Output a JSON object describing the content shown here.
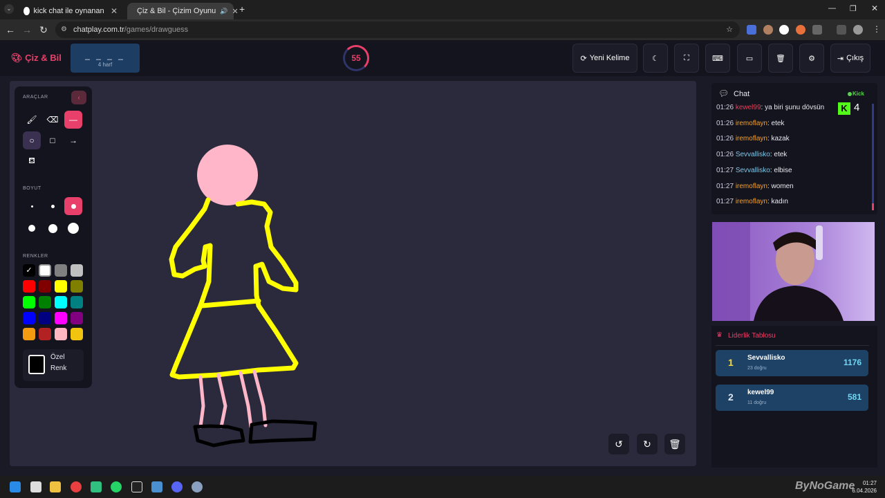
{
  "browser": {
    "tabs": [
      {
        "title": "kick chat ile oynanan oyunlar -",
        "active": false
      },
      {
        "title": "Çiz & Bil - Çizim Oyunu",
        "active": true
      }
    ],
    "url_host": "chatplay.com.tr",
    "url_path": "/games/drawguess"
  },
  "header": {
    "logo": "Çiz & Bil",
    "word_blanks": "_ _ _ _",
    "word_hint": "4 harf",
    "timer": "55",
    "new_word_label": "Yeni Kelime",
    "exit_label": "Çıkış"
  },
  "tools": {
    "section_tools": "ARAÇLAR",
    "section_size": "BOYUT",
    "section_colors": "RENKLER",
    "custom_color_line1": "Özel",
    "custom_color_line2": "Renk",
    "colors": [
      "#000000",
      "#ffffff",
      "#808080",
      "#c0c0c0",
      "#ff0000",
      "#800000",
      "#ffff00",
      "#808000",
      "#00ff00",
      "#008000",
      "#00ffff",
      "#008080",
      "#0000ff",
      "#000080",
      "#ff00ff",
      "#800080",
      "#f39c12",
      "#b22222",
      "#ffb6c1",
      "#f1c40f"
    ],
    "selected_color": "#ffffff"
  },
  "chat": {
    "title": "Chat",
    "source": "Kick",
    "messages": [
      {
        "time": "01:26",
        "user": "kewel99",
        "user_color": "#e0405a",
        "text": ": ya biri şunu dövsün"
      },
      {
        "time": "01:26",
        "user": "iremoflayn",
        "user_color": "#f0a030",
        "text": ": etek"
      },
      {
        "time": "01:26",
        "user": "iremoflayn",
        "user_color": "#f0a030",
        "text": ": kazak"
      },
      {
        "time": "01:26",
        "user": "Sevvallisko",
        "user_color": "#7ec8e8",
        "text": ": etek"
      },
      {
        "time": "01:27",
        "user": "Sevvallisko",
        "user_color": "#7ec8e8",
        "text": ": elbise"
      },
      {
        "time": "01:27",
        "user": "iremoflayn",
        "user_color": "#f0a030",
        "text": ": women"
      },
      {
        "time": "01:27",
        "user": "iremoflayn",
        "user_color": "#f0a030",
        "text": ": kadın"
      }
    ]
  },
  "leaderboard": {
    "title": "Liderlik Tablosu",
    "rows": [
      {
        "rank": "1",
        "name": "Sevvallisko",
        "sub": "23 doğru",
        "score": "1176",
        "rank_color": "#f5d742"
      },
      {
        "rank": "2",
        "name": "kewel99",
        "sub": "11 doğru",
        "score": "581",
        "rank_color": "#dfe7f5"
      }
    ]
  },
  "taskbar": {
    "time": "01:27",
    "date": "6.04.2026",
    "watermark": "ByNoGame"
  },
  "colors": {
    "accent": "#e8406a",
    "canvas_bg": "#2a2a3c",
    "panel_bg": "#14141e"
  }
}
